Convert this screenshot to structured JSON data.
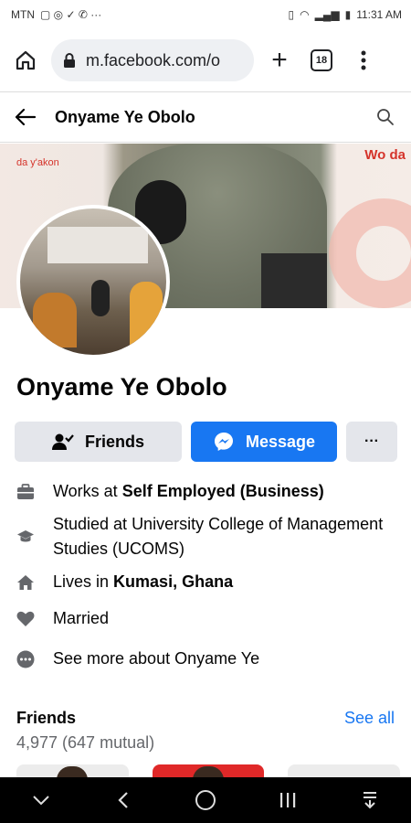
{
  "status_bar": {
    "carrier": "MTN",
    "time": "11:31 AM"
  },
  "browser": {
    "url": "m.facebook.com/o",
    "tab_count": "18"
  },
  "header": {
    "title": "Onyame Ye Obolo"
  },
  "cover": {
    "brand_text": "Wo da",
    "sub_text": "da y'akon"
  },
  "profile": {
    "name": "Onyame Ye Obolo"
  },
  "actions": {
    "friends_label": "Friends",
    "message_label": "Message",
    "more_label": "···"
  },
  "details": {
    "work_prefix": "Works at ",
    "work_place": "Self Employed (Business)",
    "study": "Studied at University College of Management Studies (UCOMS)",
    "lives_prefix": "Lives in ",
    "lives_place": "Kumasi, Ghana",
    "relationship": "Married",
    "see_more": "See more about Onyame Ye"
  },
  "friends": {
    "title": "Friends",
    "count": "4,977 (647 mutual)",
    "see_all": "See all"
  },
  "colors": {
    "accent": "#1877f2",
    "button_gray": "#e4e6eb"
  }
}
